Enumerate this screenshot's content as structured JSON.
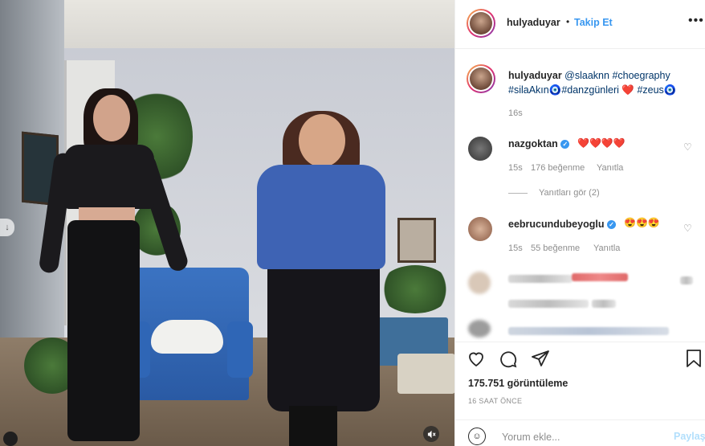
{
  "post": {
    "username": "hulyaduyar",
    "dot": "•",
    "follow_label": "Takip Et",
    "more_label": "•••"
  },
  "caption": {
    "username": "hulyaduyar",
    "mention": "@slaaknn",
    "tag1": "#choegraphy",
    "tag2": "#silaAkın",
    "tag3": "#danzgünleri",
    "tag4": "#zeus",
    "time": "16s"
  },
  "comments": [
    {
      "username": "nazgoktan",
      "emojis": "❤️❤️❤️❤️",
      "time": "15s",
      "likes": "176 beğenme",
      "reply": "Yanıtla",
      "view_replies": "Yanıtları gör (2)"
    },
    {
      "username": "eebrucundubeyoglu",
      "emojis": "😍😍😍",
      "time": "15s",
      "likes": "55 beğenme",
      "reply": "Yanıtla"
    }
  ],
  "icons": {
    "heart": "heart-icon",
    "comment": "comment-icon",
    "share": "share-icon",
    "save": "bookmark-icon",
    "mute": "mute-icon",
    "emoji": "emoji-icon"
  },
  "stats": {
    "views": "175.751 görüntüleme",
    "ago": "16 SAAT ÖNCE"
  },
  "comment_box": {
    "placeholder": "Yorum ekle...",
    "post_label": "Paylaş"
  },
  "colors": {
    "accent": "#3897f0",
    "text": "#262626",
    "muted": "#8e8e8e"
  }
}
